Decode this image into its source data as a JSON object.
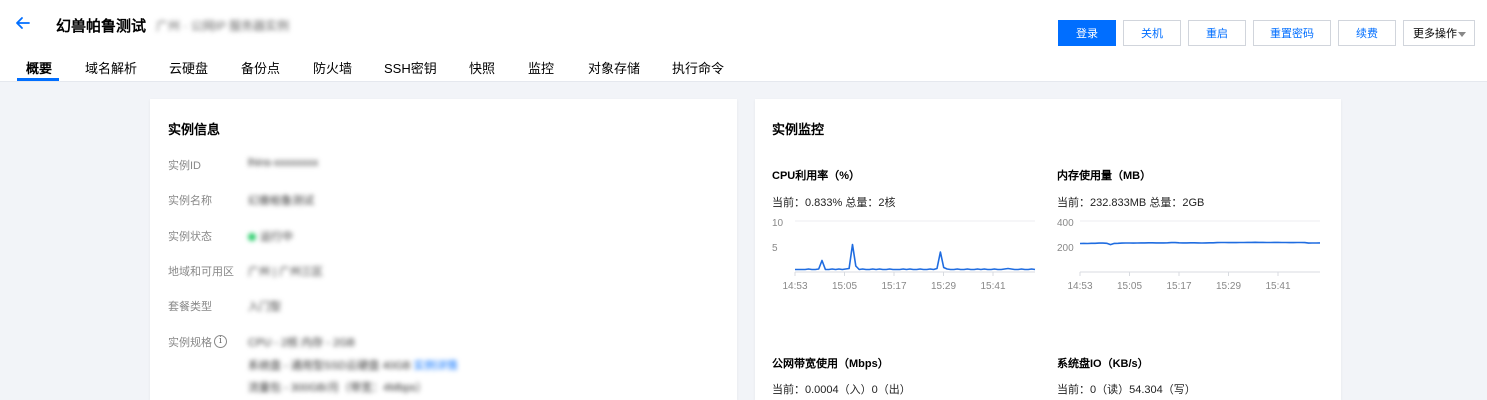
{
  "header": {
    "title": "幻兽帕鲁测试",
    "subtitle": "广州 · 公网IP 服务器实例",
    "actions": {
      "login": "登录",
      "shutdown": "关机",
      "restart": "重启",
      "reset_password": "重置密码",
      "renew": "续费",
      "more": "更多操作"
    }
  },
  "tabs": [
    "概要",
    "域名解析",
    "云硬盘",
    "备份点",
    "防火墙",
    "SSH密钥",
    "快照",
    "监控",
    "对象存储",
    "执行命令"
  ],
  "instance_info": {
    "title": "实例信息",
    "rows": [
      {
        "label": "实例ID",
        "value": "lhins-xxxxxxxx"
      },
      {
        "label": "实例名称",
        "value": "幻兽帕鲁测试"
      },
      {
        "label": "实例状态",
        "value": "运行中"
      },
      {
        "label": "地域和可用区",
        "value": "广州 | 广州三区"
      },
      {
        "label": "套餐类型",
        "value": "入门型"
      },
      {
        "label": "实例规格",
        "value": "CPU - 2核 内存 - 2GB"
      }
    ],
    "spec_extra": [
      "系统盘 - 通用型SSD云硬盘 40GB",
      "流量包 - 300GB/月（带宽：4Mbps）"
    ],
    "spec_link": "实例详情"
  },
  "monitor": {
    "title": "实例监控",
    "cpu": {
      "title": "CPU利用率（%）",
      "current_label": "当前：",
      "current": "0.833%",
      "total_label": "总量：",
      "total": "2核"
    },
    "memory": {
      "title": "内存使用量（MB）",
      "current_label": "当前：",
      "current": "232.833MB",
      "total_label": "总量：",
      "total": "2GB"
    },
    "bandwidth": {
      "title": "公网带宽使用（Mbps）",
      "current_label": "当前：",
      "in_value": "0.0004",
      "in_label": "（入）",
      "out_value": "0",
      "out_label": "（出）"
    },
    "disk": {
      "title": "系统盘IO（KB/s）",
      "current_label": "当前：",
      "read_value": "0",
      "read_label": "（读）",
      "write_value": "54.304",
      "write_label": "（写）"
    }
  },
  "chart_data": [
    {
      "type": "line",
      "title": "CPU利用率（%）",
      "x_ticks": [
        "14:53",
        "15:05",
        "15:17",
        "15:29",
        "15:41"
      ],
      "y_ticks": [
        5,
        10
      ],
      "ylim": [
        0,
        10
      ],
      "color": "#1f6ce0",
      "grid": true,
      "values": [
        0.5,
        0.5,
        0.5,
        0.5,
        0.6,
        0.5,
        0.5,
        0.6,
        2.3,
        0.5,
        0.5,
        0.6,
        0.5,
        0.6,
        0.5,
        0.6,
        0.7,
        5.5,
        1.2,
        0.5,
        0.6,
        0.5,
        0.5,
        0.6,
        0.5,
        0.6,
        0.5,
        0.5,
        0.6,
        0.5,
        0.5,
        0.5,
        0.6,
        0.5,
        0.6,
        0.5,
        0.5,
        0.6,
        0.5,
        0.5,
        0.6,
        0.5,
        0.7,
        4.0,
        0.9,
        0.6,
        0.5,
        0.5,
        0.6,
        0.5,
        0.5,
        0.6,
        0.5,
        0.5,
        0.6,
        0.5,
        0.6,
        0.5,
        0.5,
        0.6,
        0.5,
        0.5,
        0.6,
        0.7,
        0.6,
        0.5,
        0.5,
        0.6,
        0.5,
        0.5,
        0.6,
        0.5
      ]
    },
    {
      "type": "line",
      "title": "内存使用量（MB）",
      "x_ticks": [
        "14:53",
        "15:05",
        "15:17",
        "15:29",
        "15:41"
      ],
      "y_ticks": [
        200,
        400
      ],
      "ylim": [
        0,
        400
      ],
      "color": "#1f6ce0",
      "grid": true,
      "values": [
        228,
        229,
        228,
        230,
        230,
        231,
        231,
        230,
        219,
        229,
        230,
        231,
        232,
        232,
        231,
        232,
        233,
        233,
        234,
        234,
        233,
        233,
        233,
        234,
        235,
        235,
        234,
        233,
        233,
        234,
        234,
        233,
        232,
        233,
        234,
        234,
        235,
        236,
        236,
        235,
        235,
        235,
        236,
        236,
        237,
        237,
        238,
        237,
        237,
        236,
        236,
        237,
        237,
        236,
        236,
        235,
        235,
        236,
        236,
        235,
        231,
        232,
        232,
        233
      ]
    }
  ]
}
